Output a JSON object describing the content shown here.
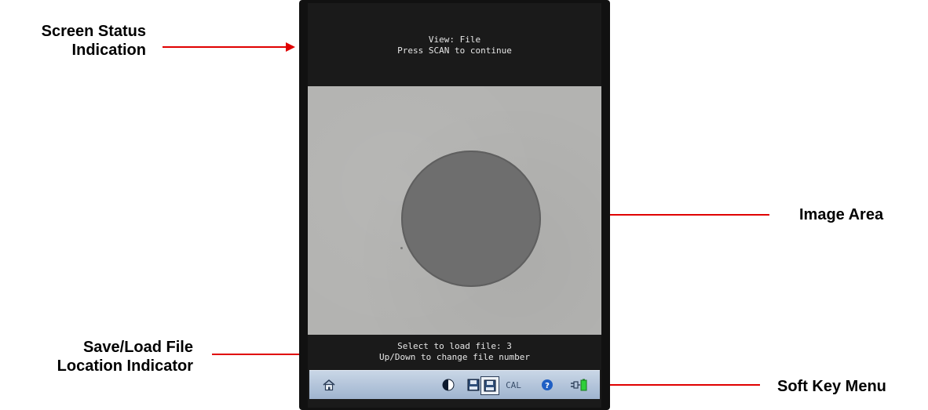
{
  "screen": {
    "status_line1": "View: File",
    "status_line2": "Press SCAN to continue",
    "file_line1": "Select to load file: 3",
    "file_line2": "Up/Down to change file number"
  },
  "softkeys": {
    "home": "home-icon",
    "contrast": "contrast-icon",
    "save": "save-icon",
    "load": "load-icon",
    "cal_label": "CAL",
    "help": "help-icon",
    "power": "power-battery-icon"
  },
  "callouts": {
    "screen_status_line1": "Screen Status",
    "screen_status_line2": "Indication",
    "image_area": "Image Area",
    "save_load_line1": "Save/Load File",
    "save_load_line2": "Location Indicator",
    "soft_key_menu": "Soft Key Menu"
  },
  "colors": {
    "arrow": "#e00000",
    "softkey_bar": "#b7c8dd",
    "image_bg": "#b3b3b1",
    "fiber_core": "#6e6e6e"
  }
}
